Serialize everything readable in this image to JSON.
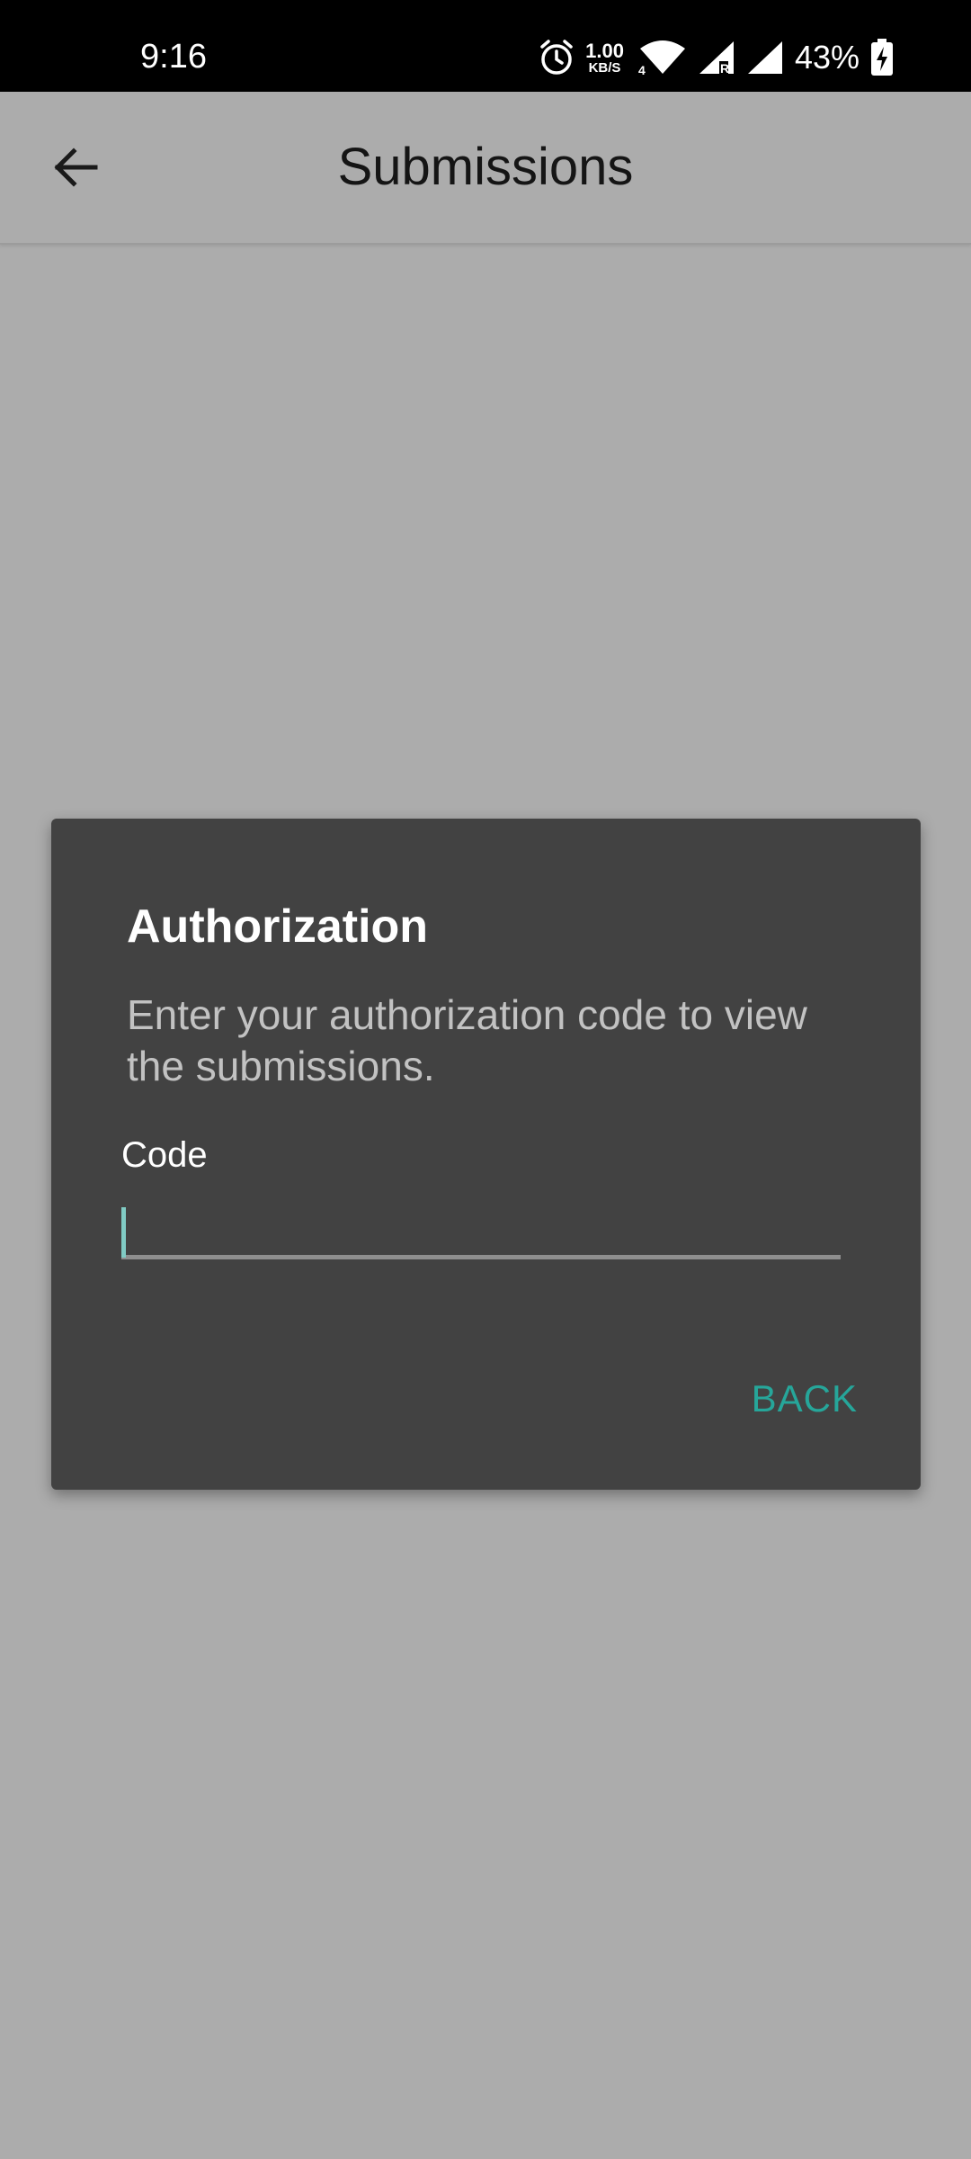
{
  "status_bar": {
    "time": "9:16",
    "net_speed_value": "1.00",
    "net_speed_unit": "KB/S",
    "battery_percent": "43%",
    "icons": [
      "alarm-icon",
      "wifi-icon",
      "signal-icon",
      "signal-roaming-icon",
      "battery-charging-icon"
    ]
  },
  "app_bar": {
    "title": "Submissions",
    "back_icon": "arrow-left-icon"
  },
  "dialog": {
    "title": "Authorization",
    "message": "Enter your authorization code to view the submissions.",
    "field_label": "Code",
    "field_value": "",
    "back_label": "BACK"
  },
  "colors": {
    "scrim": "#acacac",
    "dialog_bg": "#424242",
    "accent": "#26a69a",
    "caret": "#80cbc4"
  }
}
